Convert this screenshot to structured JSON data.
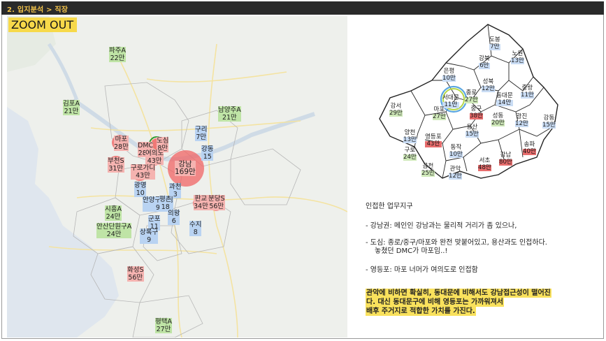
{
  "header": {
    "title": "2. 입지분석 > 직장"
  },
  "zoom_label": "ZOOM OUT",
  "map_labels": {
    "paju": [
      "파주A",
      "22만"
    ],
    "gimpo": [
      "김포A",
      "21만"
    ],
    "namyangju": [
      "남양주A",
      "21만"
    ],
    "mapo": [
      "마포",
      "28만"
    ],
    "dmc": [
      "DMC",
      "28만"
    ],
    "dosim": [
      "도심",
      "8만"
    ],
    "yeouido": [
      "여의도",
      "43만"
    ],
    "bucheon": [
      "부천S",
      "31만"
    ],
    "guro": [
      "구로가디",
      "43만"
    ],
    "gangnam": [
      "강남",
      "169만"
    ],
    "sihwa": [
      "시흥A",
      "24만"
    ],
    "ansan": [
      "안산단원구A",
      "24만"
    ],
    "pangyo": [
      "판교",
      "34만"
    ],
    "bundang": [
      "분당S",
      "56만"
    ],
    "hwaseong": [
      "화성S",
      "56만"
    ],
    "pyeongtaek": [
      "평택A",
      "27만"
    ],
    "guri": [
      "구리",
      "7만"
    ],
    "gangdong": [
      "강동",
      "15"
    ],
    "gwacheon": [
      "과천",
      "3"
    ],
    "gwangmyeong": [
      "광명",
      "10"
    ],
    "anyang": [
      "안양구도심",
      "9"
    ],
    "pyeongchon": [
      "평촌",
      "18"
    ],
    "uiwang": [
      "의왕",
      "6"
    ],
    "gunpo": [
      "군포",
      "11"
    ],
    "suji": [
      "수지",
      "8"
    ],
    "sanbon": [
      "상록구",
      "9"
    ]
  },
  "seoul_labels": {
    "dobong": [
      "도봉",
      "7만"
    ],
    "nowon": [
      "노원",
      "13만"
    ],
    "gangbuk": [
      "강북",
      "6만"
    ],
    "eunpyeong": [
      "은평",
      "10만"
    ],
    "seongbuk": [
      "성북",
      "12만"
    ],
    "jongno": [
      "종로",
      "27만"
    ],
    "seodaemun": [
      "서대문",
      "11만"
    ],
    "dongdaemun": [
      "동대문",
      "14만"
    ],
    "jungnang": [
      "중랑",
      "11만"
    ],
    "gangseo": [
      "강서",
      "29만"
    ],
    "mapo": [
      "마포",
      "27만"
    ],
    "junggu": [
      "중구",
      "38만"
    ],
    "seongdong": [
      "성동",
      "20만"
    ],
    "gwangjin": [
      "광진",
      "12만"
    ],
    "gangdong": [
      "강동",
      "15만"
    ],
    "yangcheon": [
      "양천",
      "13만"
    ],
    "yeongdeungpo": [
      "영등포",
      "43만"
    ],
    "yongsan": [
      "용산",
      "15만"
    ],
    "songpa": [
      "송파",
      "40만"
    ],
    "guro": [
      "구로",
      "24만"
    ],
    "dongjak": [
      "동작",
      "10만"
    ],
    "seocho": [
      "서초",
      "48만"
    ],
    "gangnam": [
      "강남",
      "80만"
    ],
    "geumcheon": [
      "금천",
      "25만"
    ],
    "gwanak": [
      "관악",
      "12만"
    ]
  },
  "notes": {
    "heading": "인접한 업무지구",
    "item1": "-  강남권: 메인인 강남과는 물리적 거리가 좀 있으나,",
    "item2_line1": "-  도심: 종로/중구/마포와 완전 맞붙어있고, 용산과도 인접하다.",
    "item2_line2": "놓쳤던 DMC가 마포임..!",
    "item3": "-  영등포: 마포 너머가 여의도로 인접함"
  },
  "highlight": {
    "line1": "관악에 비하면 확실히, 동대문에 비해서도 강남접근성이 떨어진",
    "line2": "다. 대신 동대문구에 비해 영등포는 가까워져서",
    "line3": "배후 주거지로 적합한 가치를 가진다."
  },
  "colors": {
    "header_bg": "#2a2a2a",
    "header_text": "#f3c34a",
    "zoom_bg": "#f7d94a",
    "highlight_bg": "#f9e15c",
    "workzone_circle": "#f06464"
  }
}
